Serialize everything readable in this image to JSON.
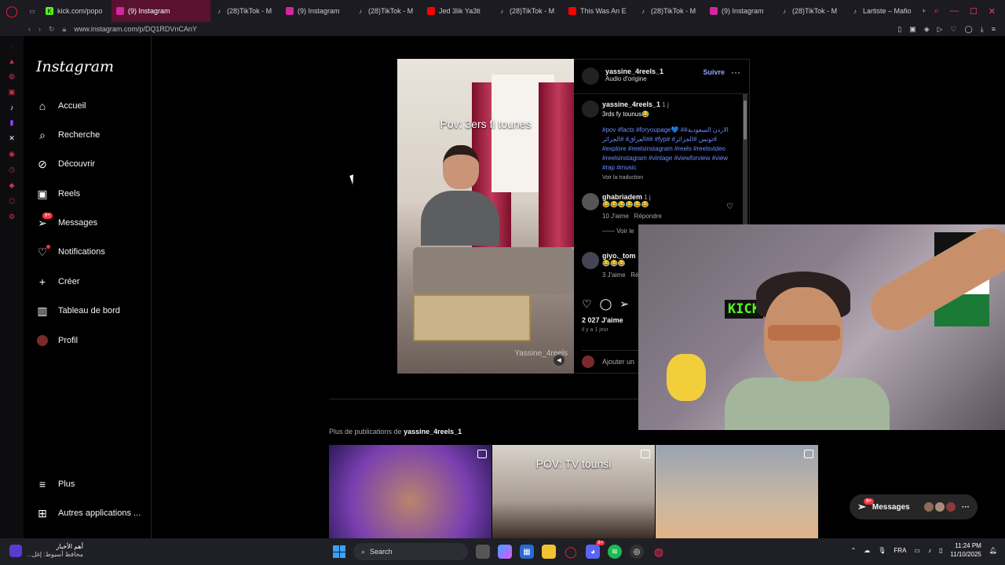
{
  "browser": {
    "tabs": [
      {
        "label": "kick.com/popo",
        "icon": "kick-icon",
        "active": false
      },
      {
        "label": "(9) Instagram",
        "icon": "instagram-icon",
        "active": true
      },
      {
        "label": "(28)TikTok - M",
        "icon": "tiktok-icon",
        "active": false
      },
      {
        "label": "(9) Instagram",
        "icon": "instagram-icon",
        "active": false
      },
      {
        "label": "(28)TikTok - M",
        "icon": "tiktok-icon",
        "active": false
      },
      {
        "label": "Jed 3lik Ya3ti",
        "icon": "youtube-icon",
        "active": false
      },
      {
        "label": "(28)TikTok - M",
        "icon": "tiktok-icon",
        "active": false
      },
      {
        "label": "This Was An E",
        "icon": "youtube-icon",
        "active": false
      },
      {
        "label": "(28)TikTok - M",
        "icon": "tiktok-icon",
        "active": false
      },
      {
        "label": "(9) Instagram",
        "icon": "instagram-icon",
        "active": false
      },
      {
        "label": "(28)TikTok - M",
        "icon": "tiktok-icon",
        "active": false
      },
      {
        "label": "Lartiste – Mafio",
        "icon": "tiktok-icon",
        "active": false
      }
    ],
    "url": "www.instagram.com/p/DQ1RDVnCAnY"
  },
  "sidebar": {
    "logo": "Instagram",
    "items": [
      {
        "label": "Accueil",
        "icon": "home-icon"
      },
      {
        "label": "Recherche",
        "icon": "search-icon"
      },
      {
        "label": "Découvrir",
        "icon": "compass-icon"
      },
      {
        "label": "Reels",
        "icon": "reels-icon"
      },
      {
        "label": "Messages",
        "icon": "messenger-icon",
        "badge": "9+"
      },
      {
        "label": "Notifications",
        "icon": "heart-icon"
      },
      {
        "label": "Créer",
        "icon": "plus-icon"
      },
      {
        "label": "Tableau de bord",
        "icon": "dashboard-icon"
      },
      {
        "label": "Profil",
        "icon": "avatar"
      }
    ],
    "bottom": [
      {
        "label": "Plus",
        "icon": "menu-icon"
      },
      {
        "label": "Autres applications ...",
        "icon": "apps-icon"
      }
    ]
  },
  "video": {
    "caption_overlay": "Pov: 3ers fi tounes",
    "watermark": "Yassine_4reels"
  },
  "post": {
    "author": "yassine_4reels_1",
    "audio": "Audio d'origine",
    "follow": "Suivre",
    "caption_user": "yassine_4reels_1",
    "caption_age": "1 j",
    "caption_text": "3rds fy tounus😂",
    "hashtags": "#pov #facts #foryoupage💙 #الاردن السعودية# #العراق# #الجزائر# #fyp# #تونس #الجزائر# #explore #reelsinstagram #reels #reelsvideo #reelsinstagram #vintage #viewforview #view #rap #music",
    "see_translation": "Voir la traduction",
    "comments": [
      {
        "user": "ghabriadem",
        "age": "1 j",
        "text": "😂😂😂😂😂😂",
        "likes": "10 J'aime",
        "reply": "Répondre",
        "replies": "Voir le"
      },
      {
        "user": "giyo._tom",
        "text": "😂😂😂",
        "likes": "3 J'aime",
        "reply": "Ré"
      }
    ],
    "like_count": "2 027 J'aime",
    "time_ago": "il y a 1 jour",
    "add_comment": "Ajouter un"
  },
  "more_posts": {
    "label_prefix": "Plus de publications de",
    "label_user": "yassine_4reels_1",
    "thumbs": [
      {
        "title": ""
      },
      {
        "title": "POV: TV tounsi"
      },
      {
        "title": ""
      }
    ]
  },
  "messages_pill": {
    "label": "Messages",
    "badge": "9+"
  },
  "webcam": {
    "sign": "KICK"
  },
  "taskbar": {
    "weather_title": "أهم الأخبار",
    "weather_sub": "محافظ أسيوط: إغل...",
    "search": "Search",
    "lang": "FRA",
    "time": "11:24 PM",
    "date": "11/10/2025",
    "discord_badge": "9+"
  }
}
